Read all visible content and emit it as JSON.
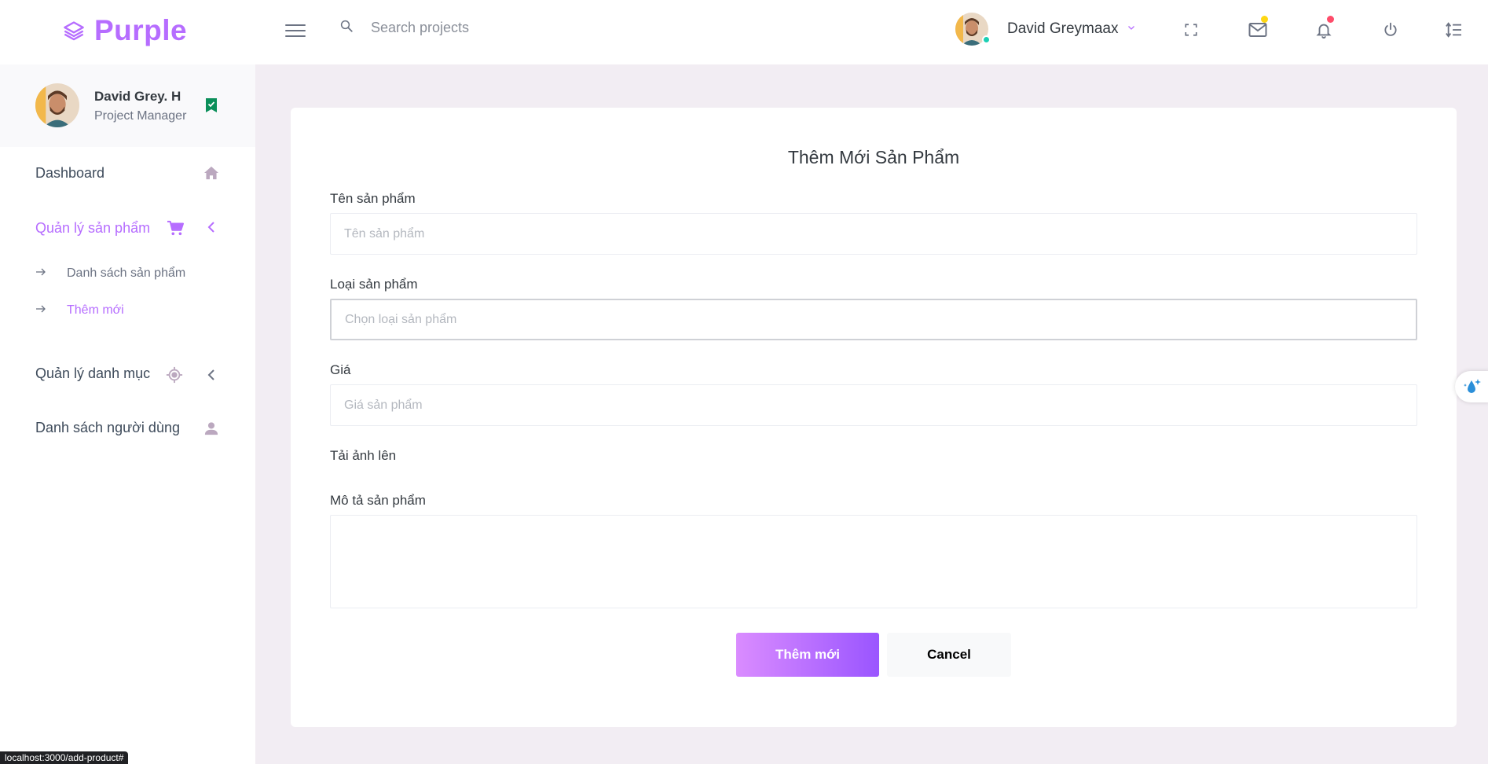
{
  "app": {
    "brand": "Purple"
  },
  "header": {
    "search_placeholder": "Search projects",
    "user_name": "David Greymaax",
    "icons": [
      "fullscreen-icon",
      "mail-icon",
      "bell-icon",
      "power-icon",
      "format-line-spacing-icon"
    ],
    "colors": {
      "mail_dot": "#fed713",
      "bell_dot": "#fe7c96",
      "online": "#1bcfb4"
    }
  },
  "sidebar": {
    "profile_name": "David Grey. H",
    "profile_role": "Project Manager",
    "items": [
      {
        "label": "Dashboard",
        "icon": "home-icon"
      },
      {
        "label": "Quản lý sản phẩm",
        "icon": "cart-icon",
        "active": true,
        "children": [
          {
            "label": "Danh sách sản phẩm"
          },
          {
            "label": "Thêm mới",
            "active": true
          }
        ]
      },
      {
        "label": "Quản lý danh mục",
        "icon": "crosshairs-icon"
      },
      {
        "label": "Danh sách người dùng",
        "icon": "account-icon"
      }
    ]
  },
  "form": {
    "title": "Thêm Mới Sản Phẩm",
    "name_label": "Tên sản phẩm",
    "name_placeholder": "Tên sản phẩm",
    "type_label": "Loại sản phẩm",
    "type_placeholder": "Chọn loại sản phẩm",
    "price_label": "Giá",
    "price_placeholder": "Giá sản phẩm",
    "upload_label": "Tải ảnh lên",
    "desc_label": "Mô tả sản phẩm",
    "submit_label": "Thêm mới",
    "cancel_label": "Cancel"
  },
  "status_bar": {
    "url": "localhost:3000/add-product#"
  },
  "theme": {
    "accent": "#b66dff",
    "background": "#f2edf3"
  }
}
